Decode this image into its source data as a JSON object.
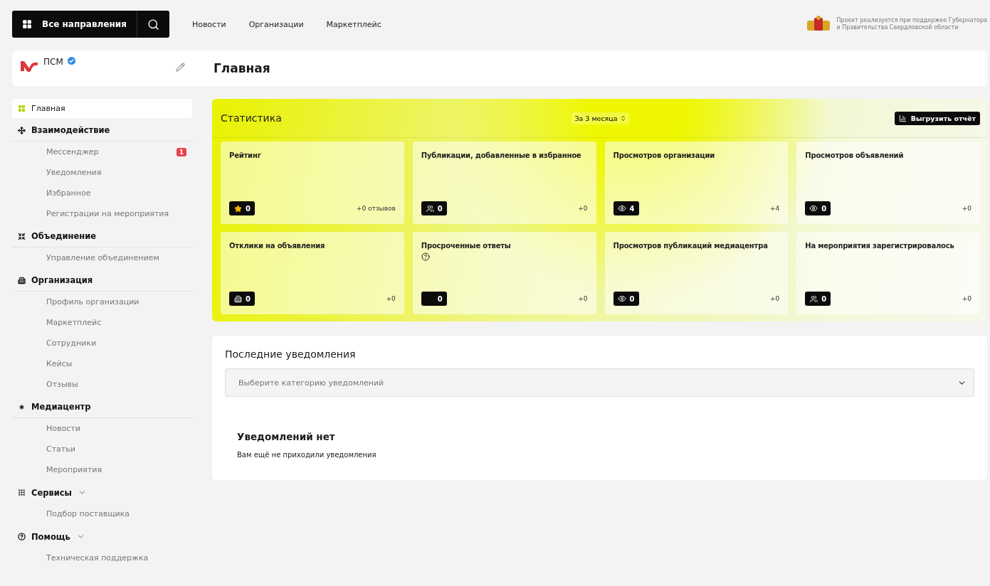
{
  "topbar": {
    "directions_button": "Все направления",
    "nav": [
      "Новости",
      "Организации",
      "Маркетплейс"
    ],
    "sponsor_text": "Проект реализуется при поддержке Губернатора\nи Правительства Свердловской области"
  },
  "org": {
    "name": "ПСМ",
    "verified": true
  },
  "page_title": "Главная",
  "sidebar": {
    "home": {
      "label": "Главная",
      "selected": true
    },
    "sections": [
      {
        "title": "Взаимодействие",
        "kind": "plain",
        "items": [
          {
            "label": "Мессенджер",
            "badge": "1"
          },
          {
            "label": "Уведомления"
          },
          {
            "label": "Избранное"
          },
          {
            "label": "Регистрации на мероприятия"
          }
        ]
      },
      {
        "title": "Объединение",
        "kind": "plain",
        "items": [
          {
            "label": "Управление объединением"
          }
        ]
      },
      {
        "title": "Организация",
        "kind": "plain",
        "items": [
          {
            "label": "Профиль организации"
          },
          {
            "label": "Маркетплейс"
          },
          {
            "label": "Сотрудники"
          },
          {
            "label": "Кейсы"
          },
          {
            "label": "Отзывы"
          }
        ]
      },
      {
        "title": "Медиацентр",
        "kind": "plain",
        "items": [
          {
            "label": "Новости"
          },
          {
            "label": "Статьи"
          },
          {
            "label": "Мероприятия"
          }
        ]
      },
      {
        "title": "Сервисы",
        "kind": "dropdown",
        "items": [
          {
            "label": "Подбор поставщика"
          }
        ]
      },
      {
        "title": "Помощь",
        "kind": "dropdown",
        "items": [
          {
            "label": "Техническая поддержка"
          }
        ]
      }
    ]
  },
  "statistics": {
    "title": "Статистика",
    "period": "За 3 месяца",
    "export_button": "Выгрузить отчёт",
    "cards": [
      {
        "title": "Рейтинг",
        "kind": "star",
        "value": "0",
        "delta": "+0 отзывов"
      },
      {
        "title": "Публикации, добавленные в избранное",
        "kind": "people",
        "value": "0",
        "delta": "+0"
      },
      {
        "title": "Просмотров организации",
        "kind": "eye",
        "value": "4",
        "delta": "+4"
      },
      {
        "title": "Просмотров объявлений",
        "kind": "eye",
        "value": "0",
        "delta": "+0"
      },
      {
        "title": "Отклики на объявления",
        "kind": "building",
        "value": "0",
        "delta": "+0"
      },
      {
        "title": "Просроченные ответы",
        "kind": "blank",
        "help": true,
        "value": "0",
        "delta": "+0"
      },
      {
        "title": "Просмотров публикаций медиацентра",
        "kind": "eye",
        "value": "0",
        "delta": "+0"
      },
      {
        "title": "На мероприятия зарегистрировалось",
        "kind": "people",
        "value": "0",
        "delta": "+0"
      }
    ]
  },
  "notifications": {
    "title": "Последние уведомления",
    "placeholder": "Выберите категорию уведомлений",
    "empty_title": "Уведомлений нет",
    "empty_text": "Вам ещё не приходили уведомления"
  }
}
